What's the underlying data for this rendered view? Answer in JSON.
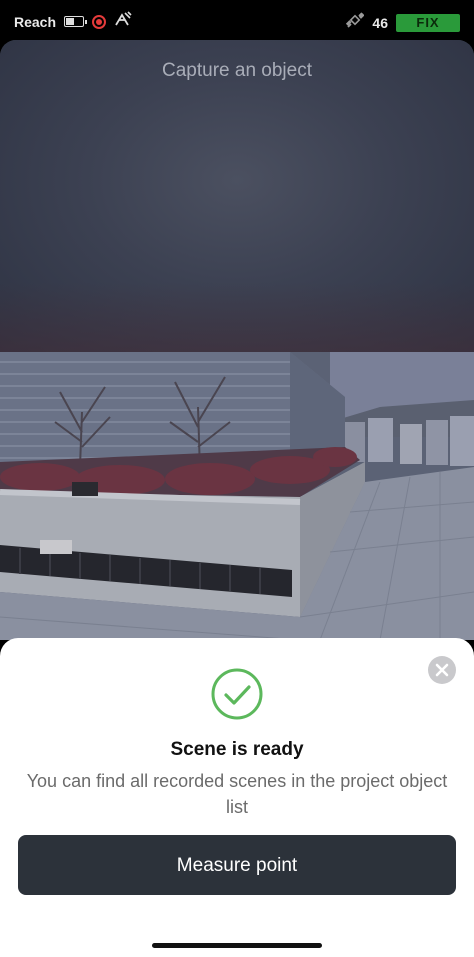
{
  "status_bar": {
    "app_name": "Reach",
    "satellite_count": "46",
    "fix_status": "FIX",
    "icons": [
      "battery-icon",
      "recording-icon",
      "antenna-icon",
      "satellite-icon"
    ]
  },
  "camera": {
    "instruction": "Capture an object"
  },
  "sheet": {
    "title": "Scene is ready",
    "message": "You can find all recorded scenes in the project object list",
    "measure_button": "Measure point",
    "icons": [
      "close-icon",
      "checkmark-icon"
    ]
  },
  "colors": {
    "fix_badge": "#2a9a3a",
    "success": "#5cb85c",
    "button_bg": "#2c323a",
    "recording": "#e53b3b"
  }
}
